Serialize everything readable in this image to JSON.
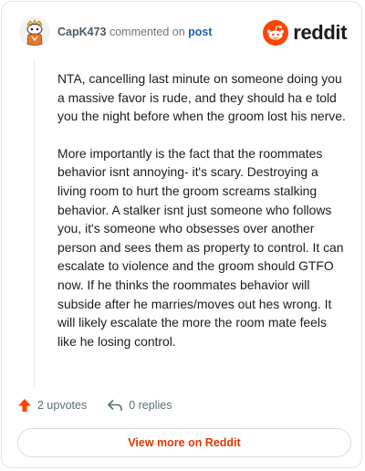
{
  "comment": {
    "username": "CapK473",
    "action_text": "commented on",
    "target_link": "post",
    "paragraphs": [
      "NTA, cancelling last minute on someone doing you a massive favor is rude, and they should ha e told you the night before when the groom lost his nerve.",
      "More importantly is the fact that the roommates behavior isnt annoying- it's scary. Destroying a living room to hurt the groom screams stalking behavior. A stalker isnt just someone who follows you, it's someone who obsesses over another person and sees them as property to control. It can escalate to violence and the groom should GTFO now. If he thinks the roommates behavior will subside after he marries/moves out hes wrong. It will likely escalate the more the room mate feels like he losing control."
    ]
  },
  "brand": {
    "name": "reddit",
    "logo_icon": "reddit-snoo-icon",
    "accent_color": "#ff4500"
  },
  "actions": {
    "upvotes_label": "2 upvotes",
    "replies_label": "0 replies",
    "upvote_icon": "upvote-arrow-icon",
    "reply_icon": "reply-arrow-icon"
  },
  "footer": {
    "view_more_label": "View more on Reddit"
  },
  "colors": {
    "upvote": "#ff4500",
    "link": "#1c5fae",
    "cta": "#d93a00"
  }
}
